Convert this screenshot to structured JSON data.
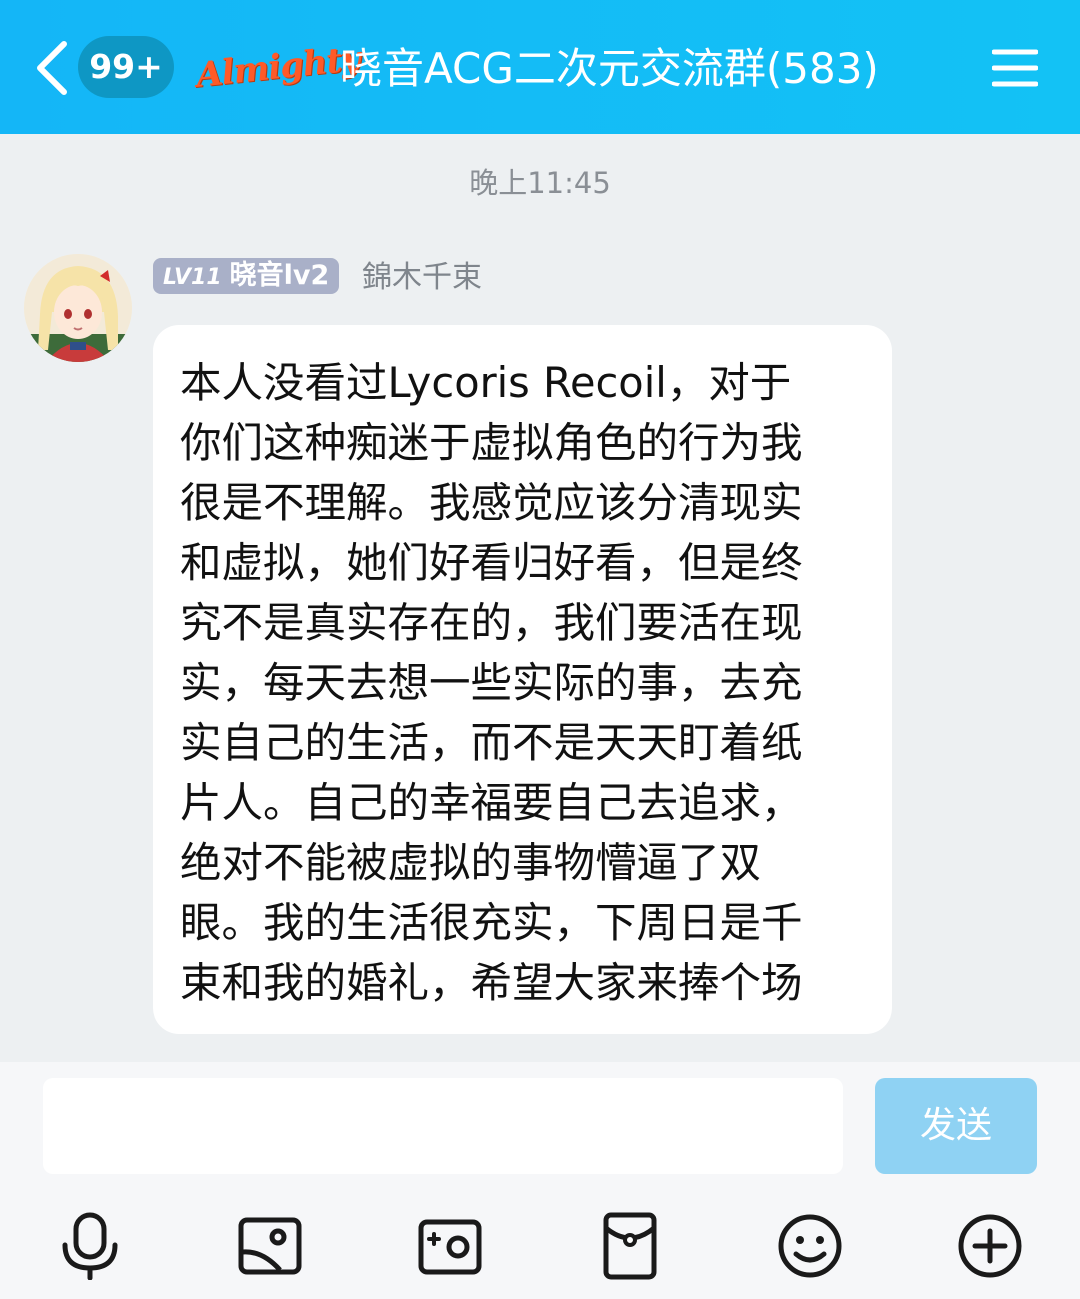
{
  "header": {
    "badge_count": "99+",
    "group_logo_text": "Almighty",
    "title": "晓音ACG二次元交流群(583)",
    "icons": {
      "back": "chevron-left-icon",
      "menu": "hamburger-menu-icon"
    }
  },
  "chat": {
    "timestamp": "晚上11:45",
    "message": {
      "level_prefix": "LV11",
      "level_title": "晓音lv2",
      "sender_name": "錦木千束",
      "lines": [
        "本人没看过Lycoris Recoil，对于",
        "你们这种痴迷于虚拟角色的行为我",
        "很是不理解。我感觉应该分清现实",
        "和虚拟，她们好看归好看，但是终",
        "究不是真实存在的，我们要活在现",
        "实，每天去想一些实际的事，去充",
        "实自己的生活，而不是天天盯着纸",
        "片人。自己的幸福要自己去追求，",
        "绝对不能被虚拟的事物懵逼了双",
        "眼。我的生活很充实，下周日是千",
        "束和我的婚礼，希望大家来捧个场"
      ]
    }
  },
  "input": {
    "value": "",
    "send_label": "发送"
  },
  "toolbar": {
    "icons": [
      "microphone-icon",
      "image-icon",
      "camera-icon",
      "red-packet-icon",
      "emoji-icon",
      "plus-icon"
    ]
  },
  "colors": {
    "header_bg": "#14b6f7",
    "badge_bg": "#0e97c4",
    "send_button_bg": "#8fd2f3",
    "level_badge_bg": "#a9b0c8"
  }
}
